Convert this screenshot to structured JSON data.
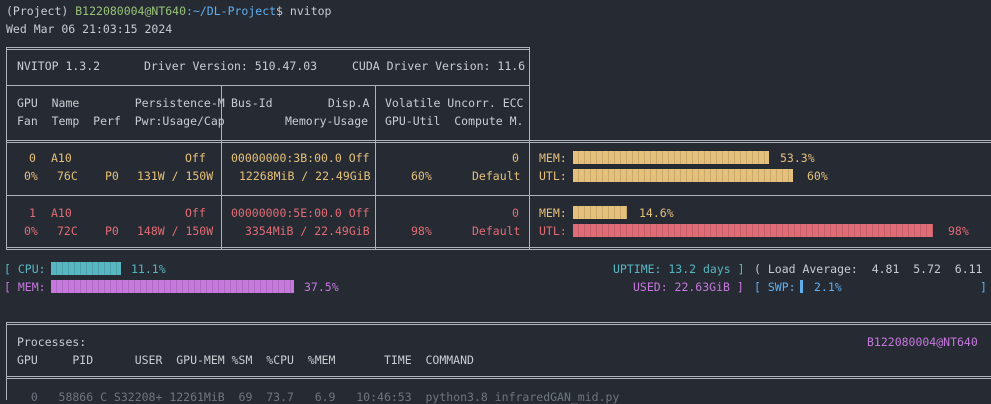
{
  "prompt": {
    "env": "(Project)",
    "user_host": "B122080004@NT640",
    "path": ":~/DL-Project",
    "symbol": "$",
    "command": "nvitop"
  },
  "datetime": "Wed Mar 06 21:03:15 2024",
  "header": {
    "nvitop": "NVITOP 1.3.2",
    "driver": "Driver Version: 510.47.03",
    "cuda": "CUDA Driver Version: 11.6"
  },
  "columns": {
    "row1_left": "GPU  Name        Persistence-M",
    "row1_mid": "Bus-Id        Disp.A",
    "row1_right": "Volatile Uncorr. ECC",
    "row2_left": "Fan  Temp  Perf  Pwr:Usage/Cap",
    "row2_mid": "Memory-Usage",
    "row2_right": "GPU-Util  Compute M."
  },
  "gpus": [
    {
      "id": "0",
      "name": "A10",
      "persistence": "Off",
      "bus": "00000000:3B:00.0 Off",
      "ecc": "0",
      "fan": "0%",
      "temp": "76C",
      "perf": "P0",
      "power": "131W / 150W",
      "memory": "12268MiB / 22.49GiB",
      "util": "60%",
      "compute": "Default",
      "mem_label": "MEM:",
      "mem_pct": "53.3%",
      "mem_frac": 0.533,
      "utl_label": "UTL:",
      "utl_pct": "60%",
      "utl_frac": 0.6
    },
    {
      "id": "1",
      "name": "A10",
      "persistence": "Off",
      "bus": "00000000:5E:00.0 Off",
      "ecc": "0",
      "fan": "0%",
      "temp": "72C",
      "perf": "P0",
      "power": "148W / 150W",
      "memory": "3354MiB / 22.49GiB",
      "util": "98%",
      "compute": "Default",
      "mem_label": "MEM:",
      "mem_pct": "14.6%",
      "mem_frac": 0.146,
      "utl_label": "UTL:",
      "utl_pct": "98%",
      "utl_frac": 0.98
    }
  ],
  "host": {
    "cpu_label": "[ CPU:",
    "cpu_pct": "11.1%",
    "cpu_frac": 0.111,
    "uptime": "UPTIME: 13.2 days ]",
    "load": "( Load Average:  4.81  5.72  6.11 )",
    "mem_label": "[ MEM:",
    "mem_pct": "37.5%",
    "mem_frac": 0.375,
    "used": "USED: 22.63GiB ]",
    "swp_label": "[ SWP:",
    "swp_pct": "2.1%",
    "swp_frac": 0.021,
    "close": "]"
  },
  "processes": {
    "title": "Processes:",
    "user_host": "B122080004@NT640",
    "header": "GPU     PID      USER  GPU-MEM %SM  %CPU  %MEM       TIME  COMMAND",
    "rows": [
      "  0   58866 C S32208+ 12261MiB  69  73.7   6.9   10:46:53  python3.8 infraredGAN_mid.py"
    ]
  },
  "colors": {
    "background": "#262b33",
    "mem_bar": "#e5c07b",
    "utl_bar_normal": "#e5c07b",
    "utl_bar_high": "#e06c75",
    "cpu_bar": "#56b6c2",
    "host_mem_bar": "#c678dd",
    "swp_bar": "#61afef"
  }
}
